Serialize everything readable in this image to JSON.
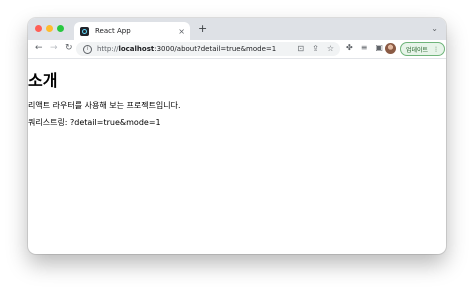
{
  "colors": {
    "close": "#ff5f57",
    "minimize": "#febc2e",
    "maximize": "#28c840",
    "update_border": "#6fb47a"
  },
  "tab": {
    "title": "React App",
    "favicon": "react-icon",
    "close_symbol": "×"
  },
  "new_tab_symbol": "+",
  "tab_menu_symbol": "⌄",
  "toolbar": {
    "back": "←",
    "forward": "→",
    "reload": "↻",
    "url_prefix": "http://",
    "url_host": "localhost",
    "url_rest": ":3000/about?detail=true&mode=1",
    "update_label": "업데이트",
    "menu_symbol": "⋮"
  },
  "page": {
    "title": "소개",
    "description": "리액트 라우터를 사용해 보는 프로젝트입니다.",
    "query_string": "쿼리스트링: ?detail=true&mode=1"
  }
}
